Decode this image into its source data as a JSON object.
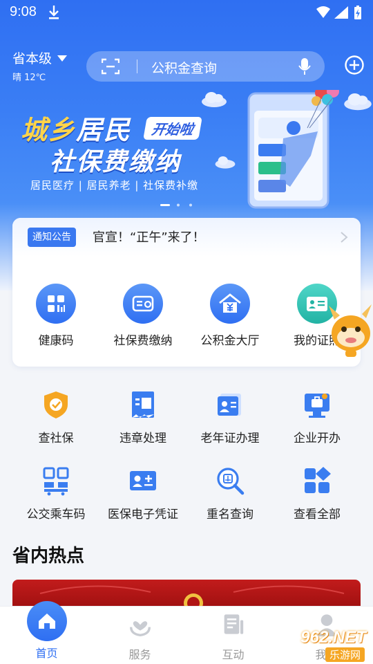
{
  "status_bar": {
    "time": "9:08",
    "icons": [
      "download-icon",
      "wifi-icon",
      "signal-icon",
      "battery-icon"
    ]
  },
  "header": {
    "location": "省本级",
    "weather": "晴 12℃",
    "search_placeholder": "公积金查询",
    "icons": [
      "scan-icon",
      "mic-icon",
      "add-icon"
    ]
  },
  "banner": {
    "title_line1_a": "城乡",
    "title_line1_b": "居民",
    "tag": "开始啦",
    "title_line2": "社保费缴纳",
    "subtitle": "居民医疗 | 居民养老 | 社保费补缴",
    "slide_count": 3,
    "active_slide": 0
  },
  "notice": {
    "badge": "通知公告",
    "message": "官宣！“正午”来了！"
  },
  "main_services": [
    {
      "label": "健康码",
      "icon": "health-code-icon",
      "color": "#3b7cf0"
    },
    {
      "label": "社保费缴纳",
      "icon": "social-security-card-icon",
      "color": "#3b7cf0"
    },
    {
      "label": "公积金大厅",
      "icon": "housing-fund-icon",
      "color": "#3b7cf0"
    },
    {
      "label": "我的证照",
      "icon": "license-icon",
      "color": "#2bbfb0"
    }
  ],
  "services": [
    {
      "label": "查社保",
      "icon": "shield-icon"
    },
    {
      "label": "违章处理",
      "icon": "ticket-icon"
    },
    {
      "label": "老年证办理",
      "icon": "id-card-icon"
    },
    {
      "label": "企业开办",
      "icon": "monitor-briefcase-icon"
    },
    {
      "label": "公交乘车码",
      "icon": "bus-qr-icon"
    },
    {
      "label": "医保电子凭证",
      "icon": "medical-card-icon"
    },
    {
      "label": "重名查询",
      "icon": "name-search-icon"
    },
    {
      "label": "查看全部",
      "icon": "grid-all-icon"
    }
  ],
  "section": {
    "title": "省内热点"
  },
  "tabs": [
    {
      "label": "首页",
      "icon": "home-icon",
      "active": true
    },
    {
      "label": "服务",
      "icon": "service-heart-icon",
      "active": false
    },
    {
      "label": "互动",
      "icon": "interact-doc-icon",
      "active": false
    },
    {
      "label": "我的",
      "icon": "user-icon",
      "active": false
    }
  ],
  "watermark": {
    "line1": "962.NET",
    "line2": "乐游网"
  },
  "colors": {
    "primary": "#2f6ff2",
    "accent_orange": "#f5a623",
    "teal": "#2bbfb0"
  }
}
